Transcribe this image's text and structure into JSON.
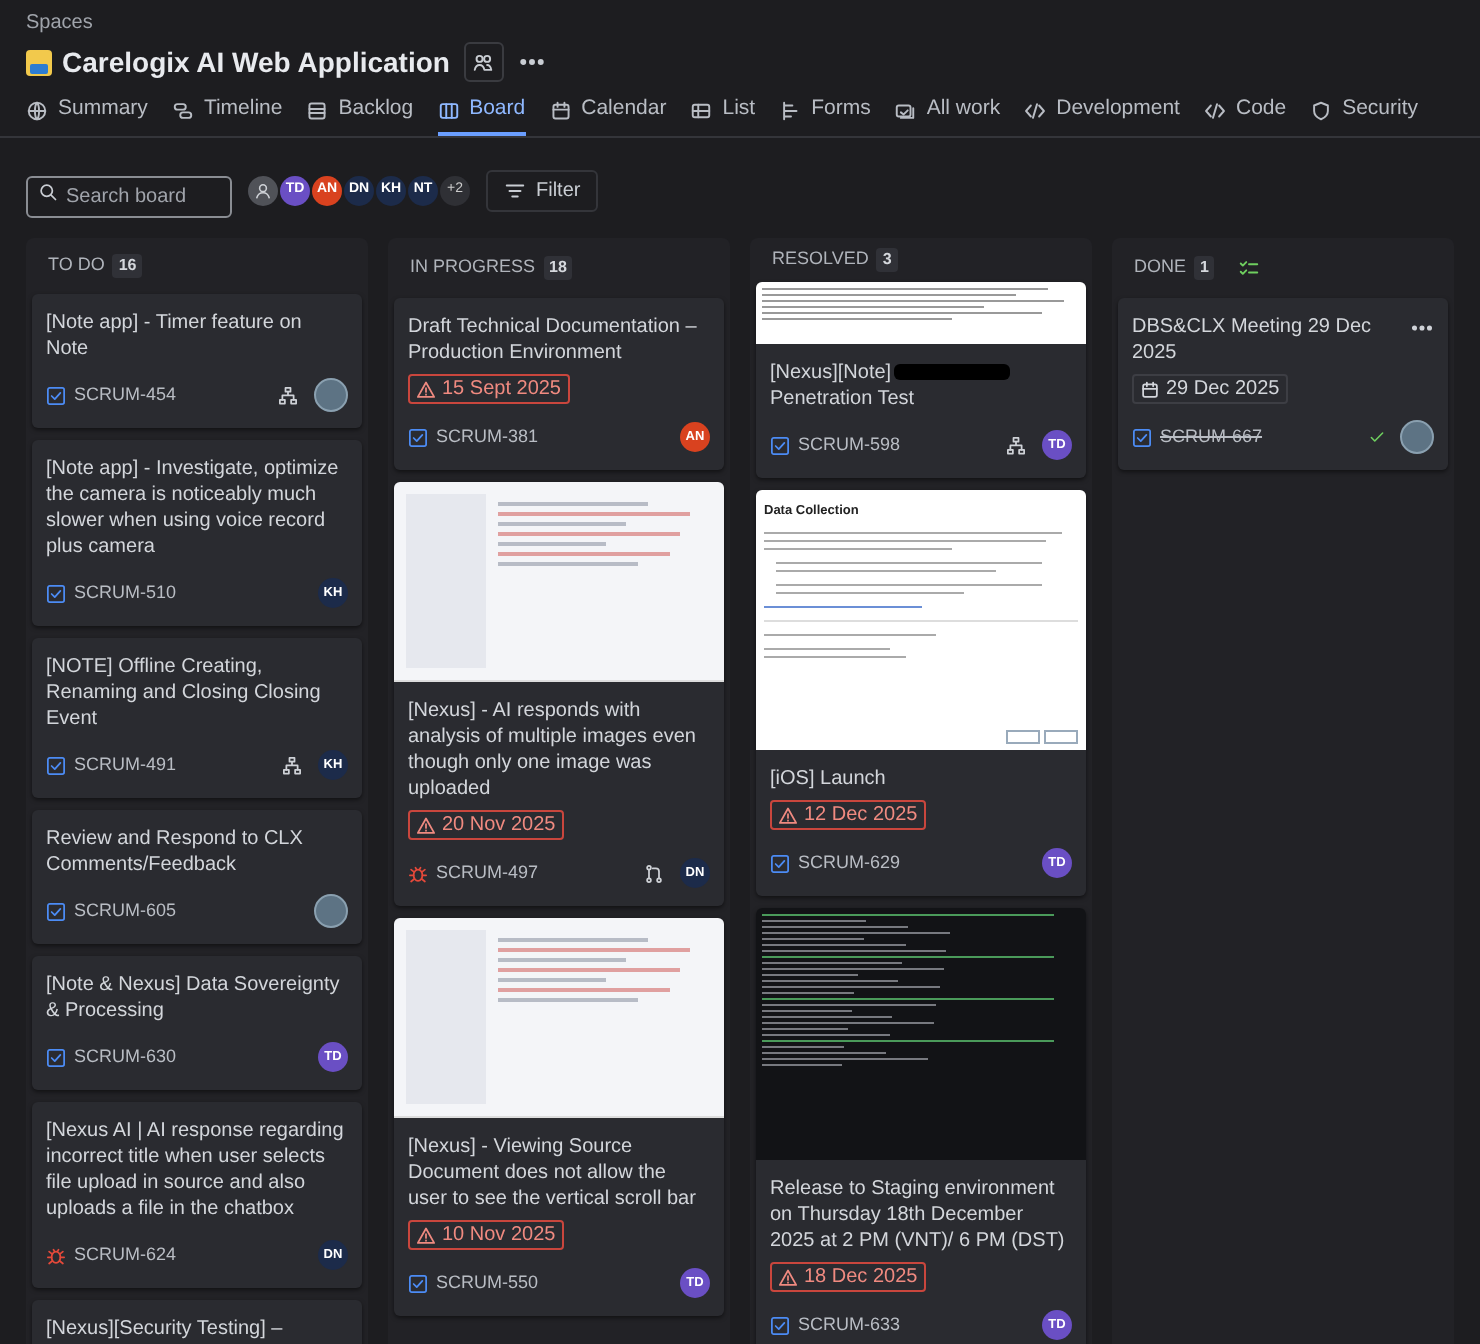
{
  "breadcrumb": "Spaces",
  "project": {
    "title": "Carelogix AI Web Application"
  },
  "tabs": [
    {
      "label": "Summary",
      "selected": false
    },
    {
      "label": "Timeline",
      "selected": false
    },
    {
      "label": "Backlog",
      "selected": false
    },
    {
      "label": "Board",
      "selected": true
    },
    {
      "label": "Calendar",
      "selected": false
    },
    {
      "label": "List",
      "selected": false
    },
    {
      "label": "Forms",
      "selected": false
    },
    {
      "label": "All work",
      "selected": false
    },
    {
      "label": "Development",
      "selected": false
    },
    {
      "label": "Code",
      "selected": false
    },
    {
      "label": "Security",
      "selected": false
    }
  ],
  "search": {
    "placeholder": "Search board"
  },
  "avatars": [
    {
      "kind": "person"
    },
    {
      "kind": "initials",
      "initials": "TD",
      "color": "#6a4fc4"
    },
    {
      "kind": "initials",
      "initials": "AN",
      "color": "#d9421f"
    },
    {
      "kind": "initials",
      "initials": "DN",
      "color": "#1c2b4a"
    },
    {
      "kind": "initials",
      "initials": "KH",
      "color": "#1c2b4a"
    },
    {
      "kind": "initials",
      "initials": "NT",
      "color": "#1c2b4a"
    },
    {
      "kind": "more",
      "initials": "+2"
    }
  ],
  "filter": {
    "label": "Filter"
  },
  "columns": [
    {
      "title": "TO DO",
      "count": "16",
      "done_icon": false,
      "cards": [
        {
          "title": "[Note app] - Timer feature on Note",
          "key": "SCRUM-454",
          "kind": "task",
          "done": false,
          "subtasks": true,
          "pr": false,
          "assignee": {
            "kind": "photo"
          }
        },
        {
          "title": "[Note app] - Investigate, optimize the camera is noticeably much slower when using voice record plus camera",
          "key": "SCRUM-510",
          "kind": "task",
          "done": false,
          "subtasks": false,
          "pr": false,
          "assignee": {
            "kind": "initials",
            "initials": "KH",
            "color": "#1c2b4a"
          }
        },
        {
          "title": "[NOTE] Offline Creating, Renaming and Closing Closing Event",
          "key": "SCRUM-491",
          "kind": "task",
          "done": false,
          "subtasks": true,
          "pr": false,
          "assignee": {
            "kind": "initials",
            "initials": "KH",
            "color": "#1c2b4a"
          }
        },
        {
          "title": "Review and Respond to CLX Comments/Feedback",
          "key": "SCRUM-605",
          "kind": "task",
          "done": false,
          "subtasks": false,
          "pr": false,
          "assignee": {
            "kind": "photo"
          }
        },
        {
          "title": "[Note & Nexus] Data Sovereignty & Processing",
          "key": "SCRUM-630",
          "kind": "task",
          "done": false,
          "subtasks": false,
          "pr": false,
          "assignee": {
            "kind": "initials",
            "initials": "TD",
            "color": "#6a4fc4"
          }
        },
        {
          "title": "[Nexus AI | AI response regarding incorrect title when user selects file upload in source and also uploads a file in the chatbox",
          "key": "SCRUM-624",
          "kind": "bug",
          "done": false,
          "subtasks": false,
          "pr": false,
          "assignee": {
            "kind": "initials",
            "initials": "DN",
            "color": "#1c2b4a"
          }
        },
        {
          "title": "[Nexus][Security Testing] –"
        }
      ]
    },
    {
      "title": "IN PROGRESS",
      "count": "18",
      "done_icon": false,
      "cards": [
        {
          "title": "Draft Technical Documentation – Production Environment",
          "due": {
            "text": "15 Sept 2025",
            "overdue": true
          },
          "key": "SCRUM-381",
          "kind": "task",
          "done": false,
          "subtasks": false,
          "pr": false,
          "assignee": {
            "kind": "initials",
            "initials": "AN",
            "color": "#d9421f"
          }
        },
        {
          "attachment": {
            "kind": "light"
          },
          "title": "[Nexus] - AI responds with analysis of multiple images even though only one image was uploaded",
          "due": {
            "text": "20 Nov 2025",
            "overdue": true
          },
          "key": "SCRUM-497",
          "kind": "bug",
          "done": false,
          "subtasks": false,
          "pr": true,
          "assignee": {
            "kind": "initials",
            "initials": "DN",
            "color": "#1c2b4a"
          }
        },
        {
          "attachment": {
            "kind": "light"
          },
          "title": "[Nexus] - Viewing Source Document does not allow the user to see the vertical scroll bar",
          "due": {
            "text": "10 Nov 2025",
            "overdue": true
          },
          "key": "SCRUM-550",
          "kind": "task",
          "done": false,
          "subtasks": false,
          "pr": false,
          "assignee": {
            "kind": "initials",
            "initials": "TD",
            "color": "#6a4fc4"
          }
        }
      ]
    },
    {
      "title": "RESOLVED",
      "count": "3",
      "done_icon": false,
      "cards": [
        {
          "attachment": {
            "kind": "strip"
          },
          "title": "[Nexus][Note]",
          "redacted": true,
          "title_after": "Penetration Test",
          "key": "SCRUM-598",
          "kind": "task",
          "done": false,
          "subtasks": true,
          "pr": false,
          "assignee": {
            "kind": "initials",
            "initials": "TD",
            "color": "#6a4fc4"
          }
        },
        {
          "attachment": {
            "kind": "form",
            "title": "Data Collection"
          },
          "title": "[iOS] Launch",
          "due": {
            "text": "12 Dec 2025",
            "overdue": true
          },
          "key": "SCRUM-629",
          "kind": "task",
          "done": false,
          "subtasks": false,
          "pr": false,
          "assignee": {
            "kind": "initials",
            "initials": "TD",
            "color": "#6a4fc4"
          }
        },
        {
          "attachment": {
            "kind": "terminal"
          },
          "title": "Release to Staging environment on Thursday 18th December 2025 at 2 PM (VNT)/ 6 PM (DST)",
          "due": {
            "text": "18 Dec 2025",
            "overdue": true
          },
          "key": "SCRUM-633",
          "kind": "task",
          "done": false,
          "subtasks": false,
          "pr": false,
          "assignee": {
            "kind": "initials",
            "initials": "TD",
            "color": "#6a4fc4"
          }
        }
      ]
    },
    {
      "title": "DONE",
      "count": "1",
      "done_icon": true,
      "cards": [
        {
          "title": "DBS&CLX Meeting 29 Dec 2025",
          "menu": true,
          "due": {
            "text": "29 Dec 2025",
            "overdue": false
          },
          "key": "SCRUM-667",
          "kind": "task",
          "done": true,
          "subtasks": false,
          "pr": false,
          "assignee": {
            "kind": "photo"
          }
        }
      ]
    }
  ]
}
